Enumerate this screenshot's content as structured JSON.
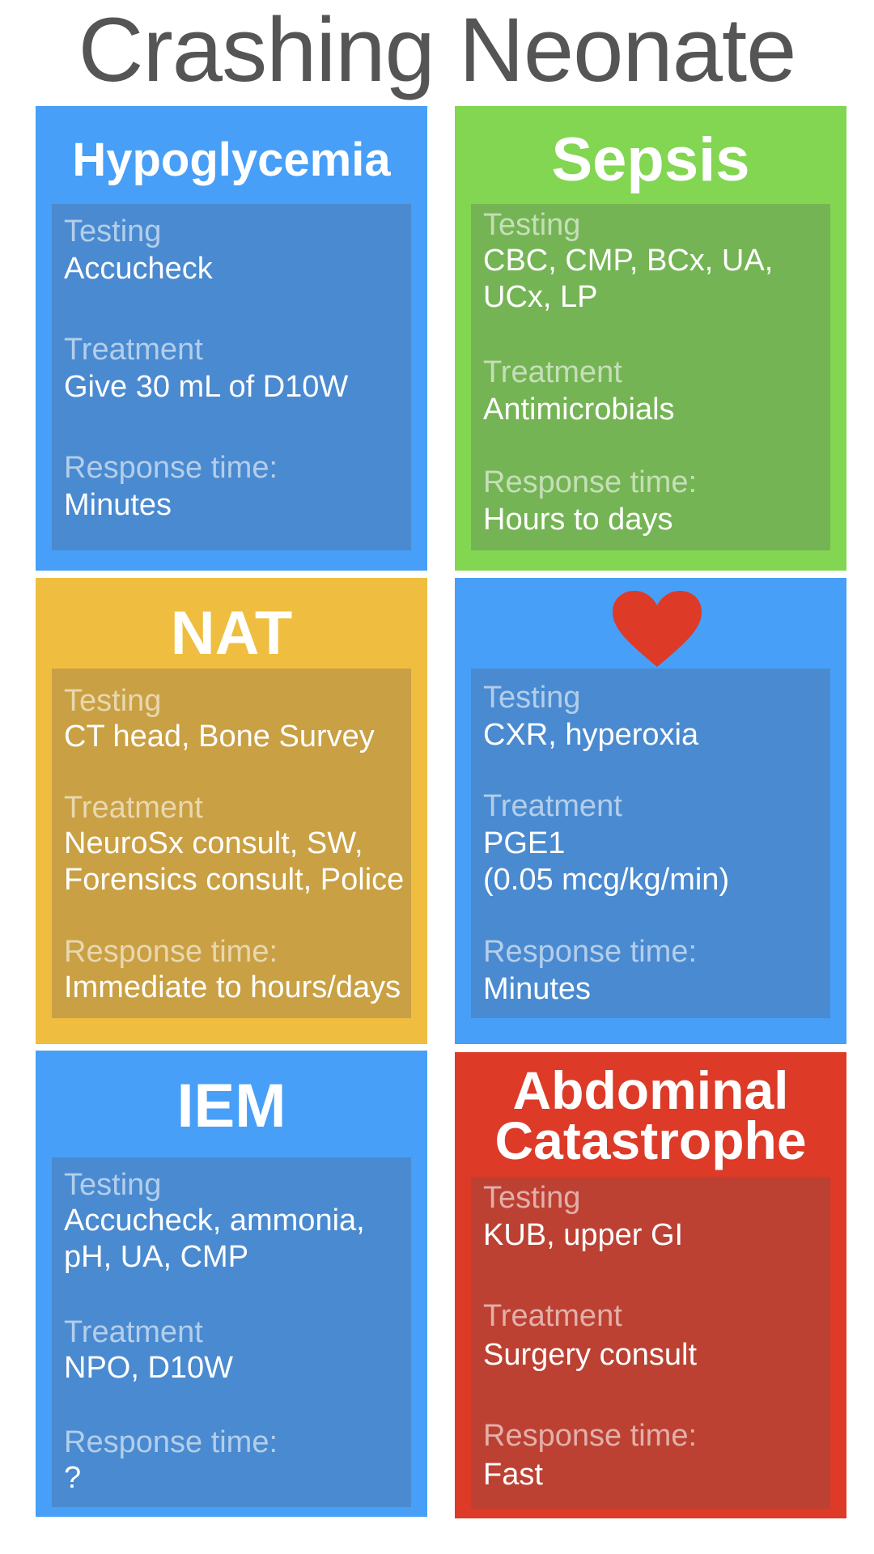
{
  "title": "Crashing Neonate",
  "colors": {
    "blue": "#479ff7",
    "green": "#82d652",
    "yellow": "#efbd40",
    "red": "#dd3a28",
    "heart": "#dd3a28"
  },
  "cards": [
    {
      "title": "Hypoglycemia",
      "testing_label": "Testing",
      "testing": "Accucheck",
      "treatment_label": "Treatment",
      "treatment": "Give 30 mL of D10W",
      "response_label": "Response time:",
      "response": "Minutes"
    },
    {
      "title": "Sepsis",
      "testing_label": "Testing",
      "testing": "CBC, CMP, BCx, UA,\nUCx, LP",
      "treatment_label": "Treatment",
      "treatment": "Antimicrobials",
      "response_label": "Response time:",
      "response": "Hours to days"
    },
    {
      "title": "NAT",
      "testing_label": "Testing",
      "testing": "CT head, Bone Survey",
      "treatment_label": "Treatment",
      "treatment": "NeuroSx consult, SW,\nForensics consult, Police",
      "response_label": "Response time:",
      "response": "Immediate to hours/days"
    },
    {
      "icon": "heart-icon",
      "testing_label": "Testing",
      "testing": "CXR, hyperoxia",
      "treatment_label": "Treatment",
      "treatment": "PGE1\n(0.05 mcg/kg/min)",
      "response_label": "Response time:",
      "response": "Minutes"
    },
    {
      "title": "IEM",
      "testing_label": "Testing",
      "testing": "Accucheck, ammonia,\npH, UA, CMP",
      "treatment_label": "Treatment",
      "treatment": "NPO, D10W",
      "response_label": "Response time:",
      "response": "?"
    },
    {
      "title": "Abdominal\nCatastrophe",
      "testing_label": "Testing",
      "testing": "KUB, upper GI",
      "treatment_label": "Treatment",
      "treatment": "Surgery consult",
      "response_label": "Response time:",
      "response": "Fast"
    }
  ]
}
